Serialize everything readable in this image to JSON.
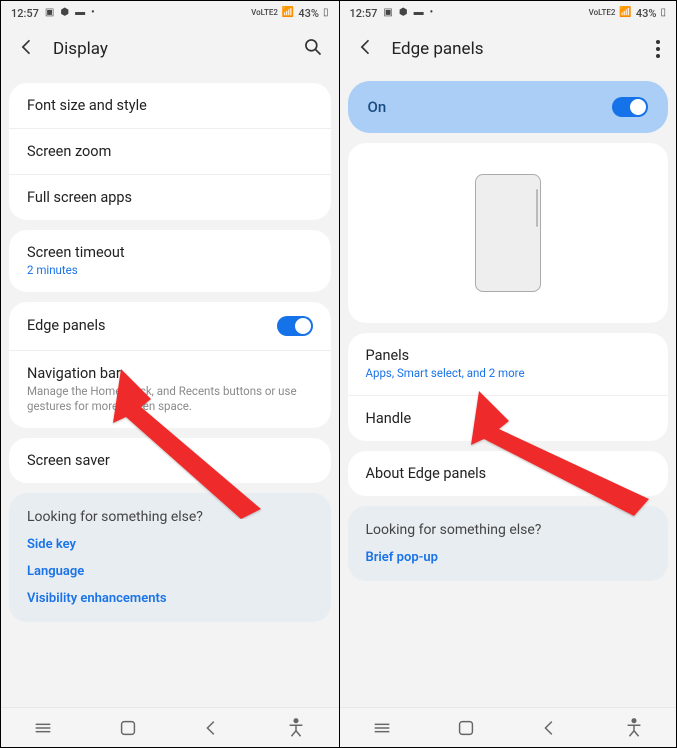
{
  "status": {
    "time": "12:57",
    "battery": "43%",
    "net": "VoLTE2"
  },
  "left": {
    "title": "Display",
    "rows": {
      "font": "Font size and style",
      "zoom": "Screen zoom",
      "fullscreen": "Full screen apps",
      "timeout": "Screen timeout",
      "timeout_sub": "2 minutes",
      "edge": "Edge panels",
      "navbar": "Navigation bar",
      "navbar_sub": "Manage the Home, Back, and Recents buttons or use gestures for more screen space.",
      "saver": "Screen saver"
    },
    "lf": {
      "title": "Looking for something else?",
      "links": [
        "Side key",
        "Language",
        "Visibility enhancements"
      ]
    }
  },
  "right": {
    "title": "Edge panels",
    "toggle_label": "On",
    "rows": {
      "panels": "Panels",
      "panels_sub": "Apps, Smart select, and 2 more",
      "handle": "Handle",
      "about": "About Edge panels"
    },
    "lf": {
      "title": "Looking for something else?",
      "links": [
        "Brief pop-up"
      ]
    }
  }
}
